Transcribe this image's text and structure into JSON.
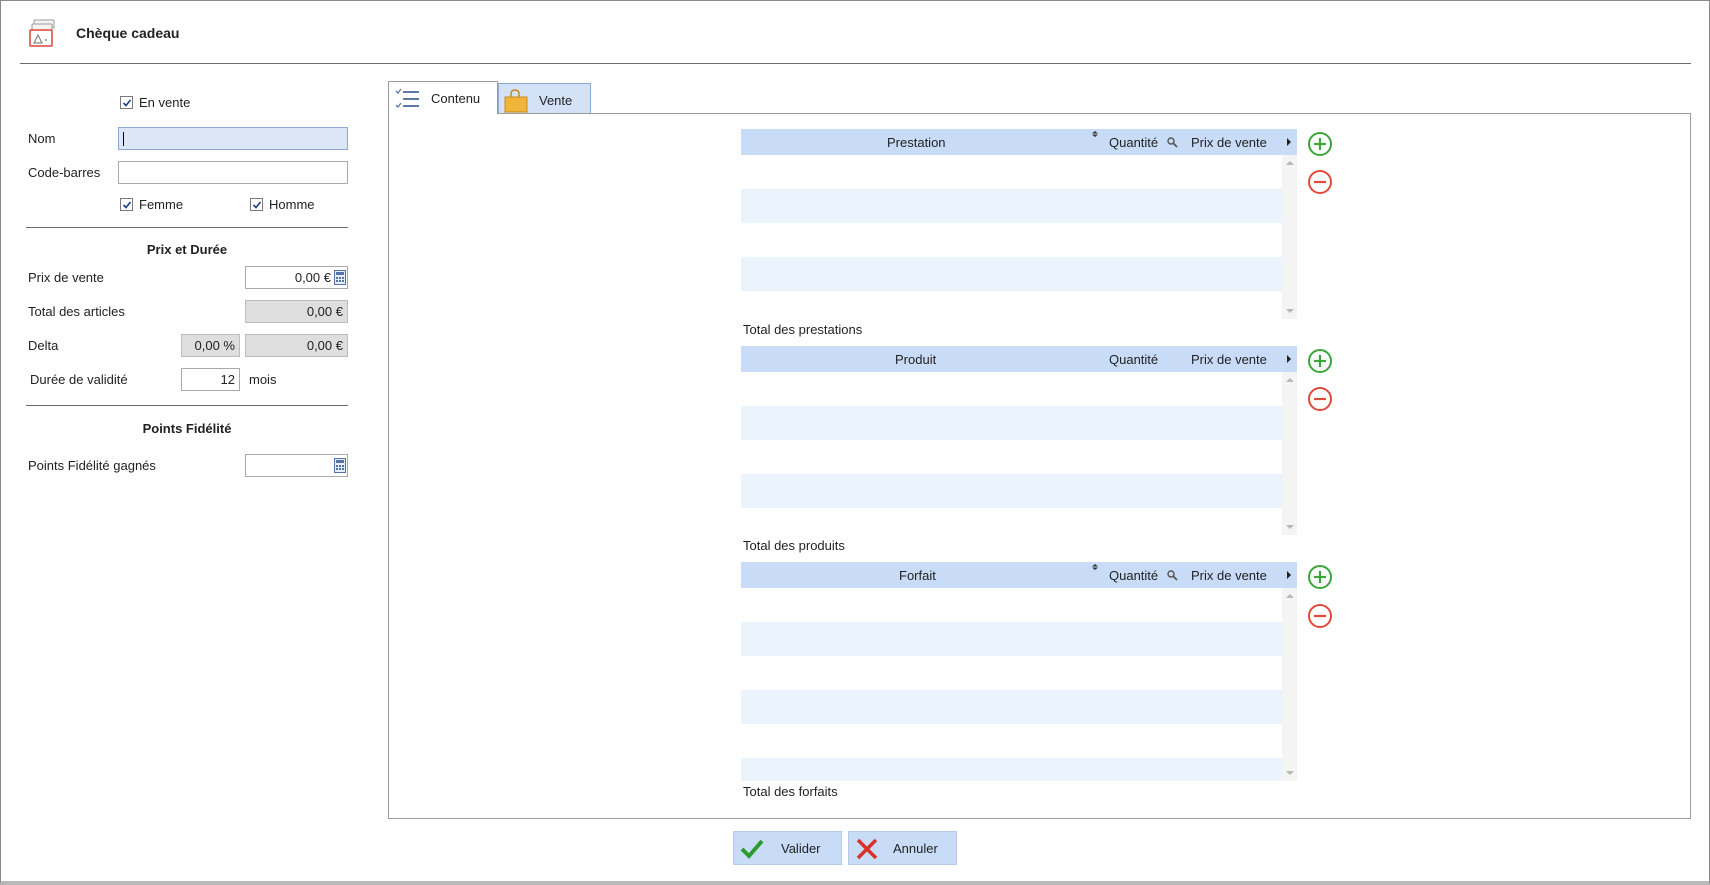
{
  "window": {
    "title": "Chèque cadeau",
    "icon": "gift-voucher-icon"
  },
  "form": {
    "en_vente": {
      "label": "En vente",
      "checked": true
    },
    "nom": {
      "label": "Nom",
      "value": ""
    },
    "code_barres": {
      "label": "Code-barres",
      "value": ""
    },
    "femme": {
      "label": "Femme",
      "checked": true
    },
    "homme": {
      "label": "Homme",
      "checked": true
    }
  },
  "prix_duree": {
    "title": "Prix et Durée",
    "prix_vente": {
      "label": "Prix de vente",
      "value": "0,00 €"
    },
    "total_articles": {
      "label": "Total des articles",
      "value": "0,00 €"
    },
    "delta": {
      "label": "Delta",
      "percent": "0,00 %",
      "value": "0,00 €"
    },
    "duree": {
      "label": "Durée de validité",
      "value": "12",
      "unit": "mois"
    }
  },
  "fidelite": {
    "title": "Points Fidélité",
    "points": {
      "label": "Points Fidélité gagnés",
      "value": ""
    }
  },
  "tabs": [
    {
      "label": "Contenu",
      "icon": "checklist-icon",
      "active": true
    },
    {
      "label": "Vente",
      "icon": "shopping-bag-icon",
      "active": false
    }
  ],
  "grids": {
    "prestations": {
      "columns": [
        "Prestation",
        "Quantité",
        "Prix de vente"
      ],
      "total_label": "Total des prestations"
    },
    "produits": {
      "columns": [
        "Produit",
        "Quantité",
        "Prix de vente"
      ],
      "total_label": "Total des produits"
    },
    "forfaits": {
      "columns": [
        "Forfait",
        "Quantité",
        "Prix de vente"
      ],
      "total_label": "Total des forfaits"
    }
  },
  "buttons": {
    "valider": {
      "label": "Valider",
      "icon": "checkmark-icon"
    },
    "annuler": {
      "label": "Annuler",
      "icon": "cross-icon"
    }
  },
  "colors": {
    "grid_header": "#c8dcf7",
    "grid_alt_row": "#ebf3fd",
    "add_button": "#3aa63a",
    "remove_button": "#e04a3a",
    "valider_check": "#2e9a2e",
    "annuler_cross": "#d9312a"
  }
}
